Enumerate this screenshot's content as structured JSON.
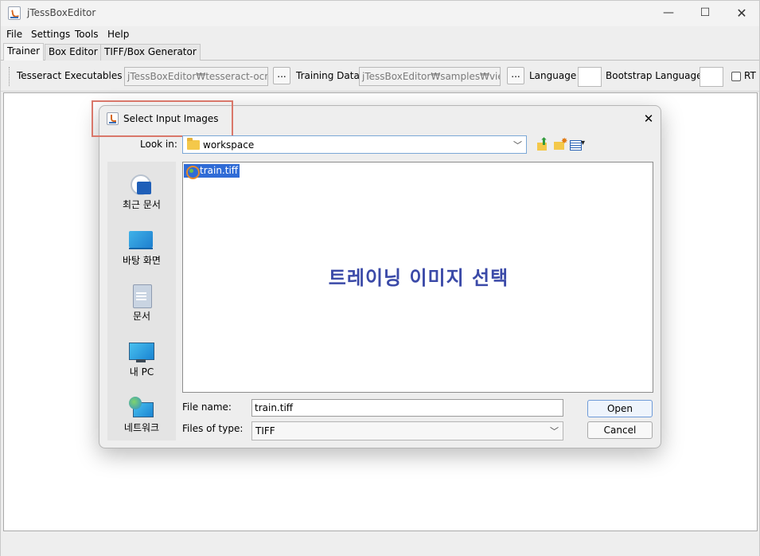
{
  "window": {
    "title": "jTessBoxEditor",
    "controls": {
      "minimize": "—",
      "maximize": "☐",
      "close": "✕"
    }
  },
  "menubar": [
    "File",
    "Settings",
    "Tools",
    "Help"
  ],
  "tabs": [
    "Trainer",
    "Box Editor",
    "TIFF/Box Generator"
  ],
  "toolbar": {
    "tesseract_label": "Tesseract Executables",
    "tesseract_value": "jTessBoxEditor₩tesseract-ocr",
    "browse_label": "...",
    "training_label": "Training Data",
    "training_value": "jTessBoxEditor₩samples₩vie",
    "language_label": "Language",
    "language_value": "",
    "bootstrap_label": "Bootstrap Language",
    "bootstrap_value": "",
    "rtl_label": "RT"
  },
  "dialog": {
    "title": "Select Input Images",
    "close": "✕",
    "look_in_label": "Look in:",
    "look_in_value": "workspace",
    "places": [
      "최근 문서",
      "바탕 화면",
      "문서",
      "내 PC",
      "네트워크"
    ],
    "files": [
      {
        "name": "train.tiff",
        "selected": true
      }
    ],
    "overlay_text": "트레이닝 이미지 선택",
    "file_name_label": "File name:",
    "file_name_value": "train.tiff",
    "file_type_label": "Files of type:",
    "file_type_value": "TIFF",
    "open_label": "Open",
    "cancel_label": "Cancel"
  },
  "colors": {
    "selection": "#2f6bd6",
    "overlay_text": "#3b4aa8",
    "highlight_box": "#d9776a"
  }
}
